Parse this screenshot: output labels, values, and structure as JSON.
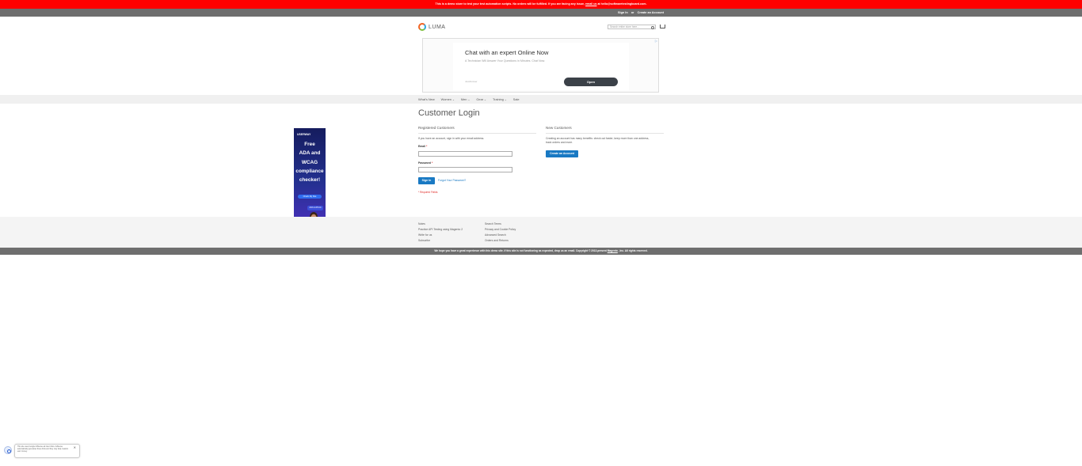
{
  "notice": {
    "text": "This is a demo store to test your test automation scripts. No orders will be fulfilled. If you are facing any issue,",
    "link": "email us",
    "tail": "at hello@softwaretestingboard.com."
  },
  "header": {
    "sign_in": "Sign In",
    "or": "or",
    "create_account": "Create an Account",
    "logo_text": "LUMA",
    "search_placeholder": "Search entire store here..."
  },
  "ad": {
    "corner": "▷",
    "title": "Chat with an expert Online Now",
    "subtitle": "A Technician Will Answer Your Questions in Minutes. Chat Now.",
    "small": "JustAnswer",
    "button": "Open"
  },
  "nav": {
    "items": [
      {
        "label": "What's New",
        "dropdown": false
      },
      {
        "label": "Women",
        "dropdown": true
      },
      {
        "label": "Men",
        "dropdown": true
      },
      {
        "label": "Gear",
        "dropdown": true
      },
      {
        "label": "Training",
        "dropdown": true
      },
      {
        "label": "Sale",
        "dropdown": false
      }
    ]
  },
  "login": {
    "page_title": "Customer Login",
    "registered_title": "Registered Customers",
    "registered_intro": "If you have an account, sign in with your email address.",
    "email_label": "Email",
    "password_label": "Password",
    "asterisk": "*",
    "sign_in_button": "Sign In",
    "forgot_link": "Forgot Your Password?",
    "required_note": "* Required Fields",
    "new_title": "New Customers",
    "new_line1": "Creating an account has many benefits: check out faster, keep more than one address,",
    "new_line2": "track orders and more.",
    "create_button": "Create an Account"
  },
  "side_ad": {
    "logo": "USERWAY",
    "line1": "Free",
    "line2": "ADA and",
    "line3": "WCAG",
    "line4": "compliance",
    "line5": "checker!",
    "button": "Check My Site",
    "badge": "ADA & WCAG",
    "close": "✕"
  },
  "footer": {
    "col1": [
      "Notes",
      "Practice API Testing using Magento 2",
      "Write for us",
      "Subscribe"
    ],
    "col2": [
      "Search Terms",
      "Privacy and Cookie Policy",
      "Advanced Search",
      "Orders and Returns"
    ]
  },
  "bottom_bar": {
    "text": "We hope you have a great experience with this demo site. If this site is not functioning as expected, drop us an email. Copyright © 2013-present",
    "link": "Magento",
    "tail": ", Inc. All rights reserved."
  },
  "cookie": {
    "text": "This site uses Google AdSense ad intent links. AdSense automatically generates these links and they may help creators earn money.",
    "close": "✕"
  }
}
